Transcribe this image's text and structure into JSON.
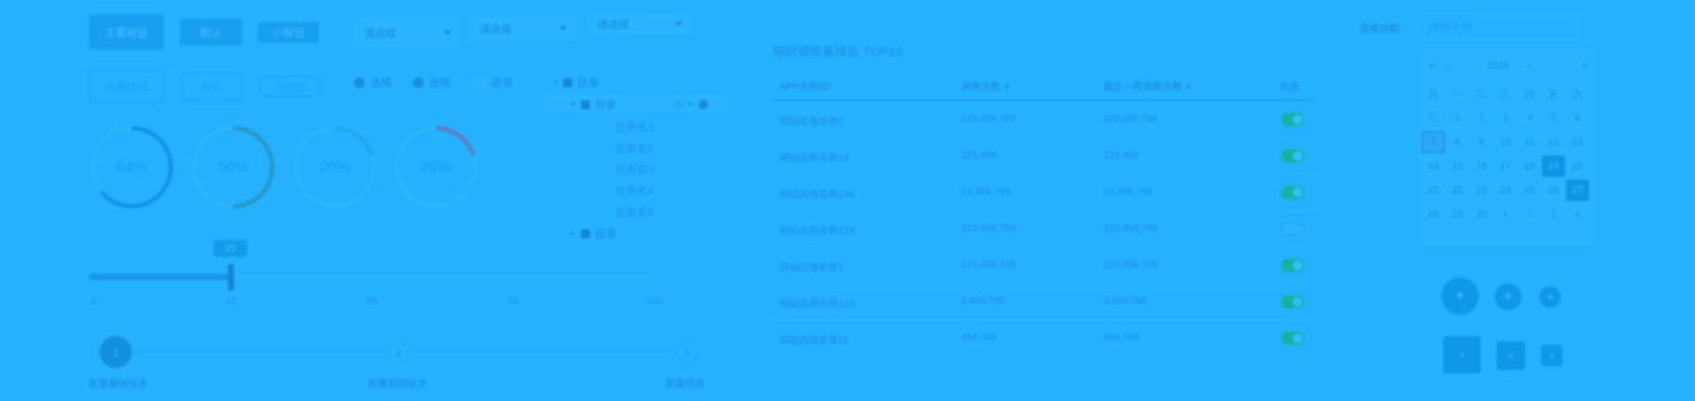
{
  "toolbar": {
    "row1": [
      {
        "label": "主要按钮"
      },
      {
        "label": "默认"
      },
      {
        "label": "小按钮"
      }
    ],
    "row2": [
      {
        "label": "次要按钮"
      },
      {
        "label": "默认"
      },
      {
        "label": "小按钮"
      }
    ]
  },
  "selects": [
    {
      "value": "请选择"
    },
    {
      "value": "请选择"
    },
    {
      "value": "请选择"
    }
  ],
  "radios": [
    {
      "label": "选项",
      "checked": true
    },
    {
      "label": "选项",
      "checked": true
    },
    {
      "label": "选项",
      "checked": false
    }
  ],
  "tree": {
    "root": "目录",
    "child": "目录",
    "child_tag": "小",
    "leaves": [
      "任务名1",
      "任务名2",
      "任务名3",
      "任务名4",
      "任务名5"
    ],
    "sibling": "目录"
  },
  "progress_circles": [
    {
      "label": "64%",
      "value": 0.64,
      "color": "#1395e6"
    },
    {
      "label": "50%",
      "value": 0.5,
      "color": "#2699c9"
    },
    {
      "label": "20%",
      "value": 0.2,
      "color": "#22a6ee"
    },
    {
      "label": "20%",
      "value": 0.2,
      "color": "#5a7fc4"
    }
  ],
  "slider": {
    "value": 25,
    "max": 100,
    "tooltip": "25",
    "ticks": [
      "0",
      "25",
      "50",
      "75",
      "100"
    ]
  },
  "steps": [
    {
      "number": "1",
      "label": "配置基础信息",
      "active": true
    },
    {
      "number": "2",
      "label": "配置规则信息",
      "active": false
    },
    {
      "number": "3",
      "label": "配置完成",
      "active": false
    }
  ],
  "table": {
    "title": "规则调用量排名 TOP10",
    "headers": [
      "APP名称/ID",
      "调用次数",
      "最近一周调用次数",
      "状态"
    ],
    "rows": [
      {
        "name": "网站应用名称1",
        "calls": "123,456,789",
        "weekly": "123,456,789",
        "enabled": true
      },
      {
        "name": "网站应用名称14",
        "calls": "123,456",
        "weekly": "123,456",
        "enabled": true
      },
      {
        "name": "网站应用名称134",
        "calls": "23,456,789",
        "weekly": "23,456,789",
        "enabled": true
      },
      {
        "name": "网站应用名称123",
        "calls": "123,456,789",
        "weekly": "123,456,789",
        "enabled": false
      },
      {
        "name": "网站应用名称1",
        "calls": "123,456,789",
        "weekly": "123,456,789",
        "enabled": true
      },
      {
        "name": "网站应用名称123",
        "calls": "3,456,789",
        "weekly": "3,456,789",
        "enabled": true
      },
      {
        "name": "网站应用名称11",
        "calls": "456,789",
        "weekly": "456,789",
        "enabled": true
      }
    ]
  },
  "datepicker": {
    "label": "选择日期:",
    "value": "2016-2-19",
    "year_nav": "2016",
    "weekdays": [
      "日",
      "一",
      "二",
      "三",
      "四",
      "五",
      "六"
    ],
    "weeks": [
      [
        "31",
        "1",
        "2",
        "3",
        "4",
        "5",
        "6"
      ],
      [
        "7",
        "8",
        "9",
        "10",
        "11",
        "12",
        "13"
      ],
      [
        "14",
        "15",
        "16",
        "17",
        "18",
        "19",
        "20"
      ],
      [
        "21",
        "22",
        "23",
        "24",
        "25",
        "26",
        "27"
      ],
      [
        "28",
        "29",
        "30",
        "1",
        "2",
        "3",
        "4"
      ]
    ]
  },
  "icon_buttons": {
    "round": [
      "+",
      "+",
      "+"
    ],
    "square": [
      "+",
      "+",
      "+"
    ]
  }
}
